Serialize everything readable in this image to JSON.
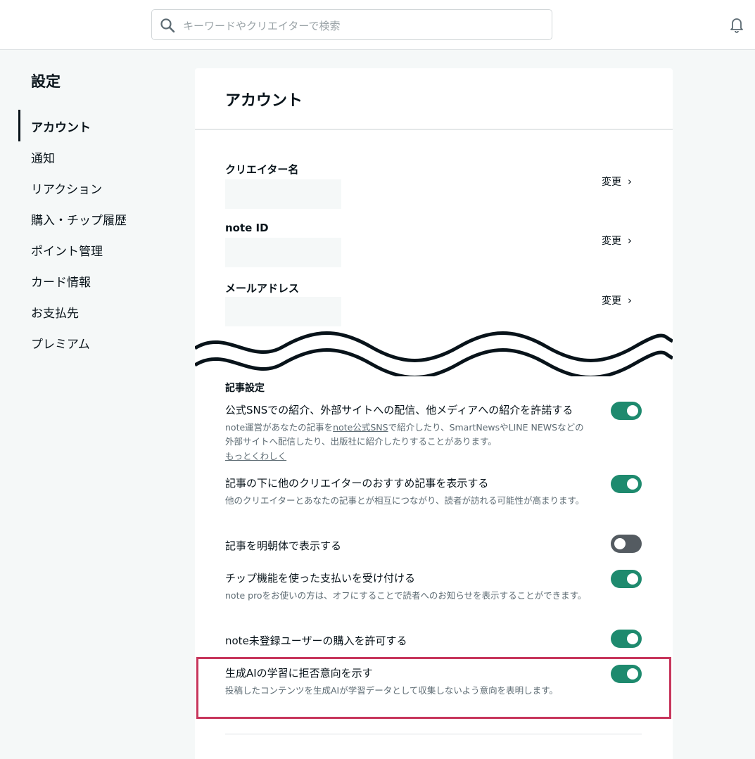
{
  "header": {
    "search_placeholder": "キーワードやクリエイターで検索",
    "search_icon": "search-icon",
    "bell_icon": "bell-icon"
  },
  "sidebar": {
    "title": "設定",
    "items": [
      {
        "label": "アカウント",
        "active": true
      },
      {
        "label": "通知"
      },
      {
        "label": "リアクション"
      },
      {
        "label": "購入・チップ履歴"
      },
      {
        "label": "ポイント管理"
      },
      {
        "label": "カード情報"
      },
      {
        "label": "お支払先"
      },
      {
        "label": "プレミアム"
      }
    ]
  },
  "main": {
    "title": "アカウント",
    "fields": [
      {
        "label": "クリエイター名",
        "change_label": "変更"
      },
      {
        "label": "note ID",
        "change_label": "変更"
      },
      {
        "label": "メールアドレス",
        "change_label": "変更"
      }
    ],
    "section_title": "記事設定",
    "settings": [
      {
        "label": "公式SNSでの紹介、外部サイトへの配信、他メディアへの紹介を許諾する",
        "desc_pre": "note運営があなたの記事を",
        "desc_link": "note公式SNS",
        "desc_post": "で紹介したり、SmartNewsやLINE NEWSなどの外部サイトへ配信したり、出版社に紹介したりすることがあります。",
        "more_link": "もっとくわしく",
        "enabled": true
      },
      {
        "label": "記事の下に他のクリエイターのおすすめ記事を表示する",
        "desc": "他のクリエイターとあなたの記事とが相互につながり、読者が訪れる可能性が高まります。",
        "enabled": true
      },
      {
        "label": "記事を明朝体で表示する",
        "enabled": false
      },
      {
        "label": "チップ機能を使った支払いを受け付ける",
        "desc": "note proをお使いの方は、オフにすることで読者へのお知らせを表示することができます。",
        "enabled": true
      },
      {
        "label": "note未登録ユーザーの購入を許可する",
        "enabled": true
      },
      {
        "label": "生成AIの学習に拒否意向を示す",
        "desc": "投稿したコンテンツを生成AIが学習データとして収集しないよう意向を表明します。",
        "enabled": true,
        "highlighted": true
      }
    ]
  },
  "colors": {
    "toggle_on": "#1e8a6e",
    "toggle_off": "#545b61",
    "highlight_border": "#c7365c",
    "page_bg": "#f5f8f8"
  }
}
